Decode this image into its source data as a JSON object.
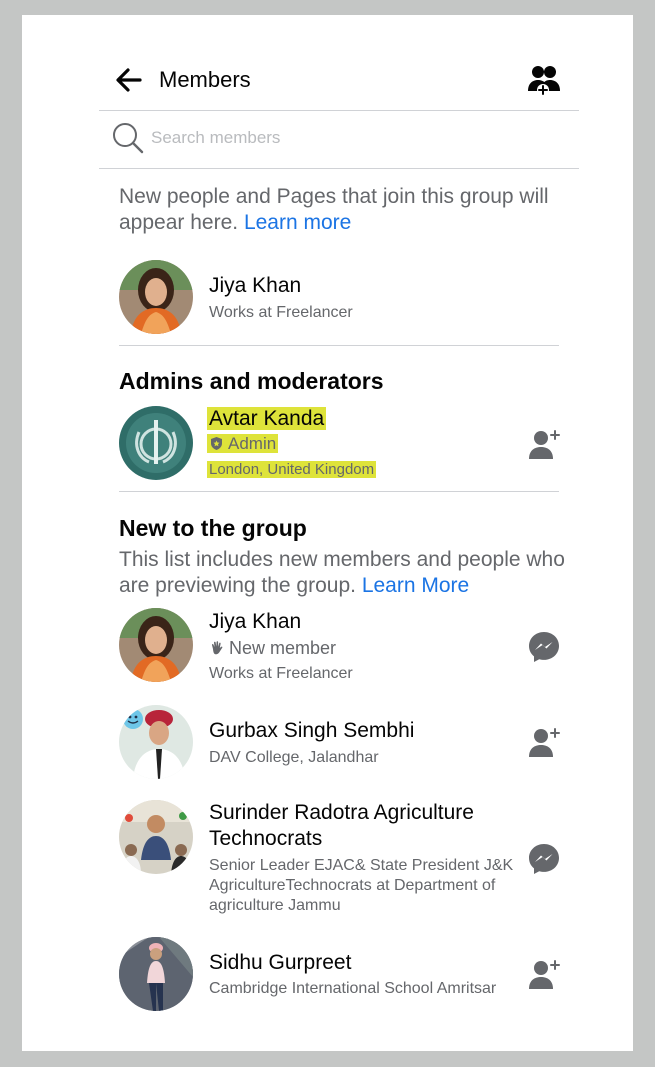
{
  "header": {
    "title": "Members",
    "back_icon": "arrow-left-icon",
    "invite_icon": "add-people-icon"
  },
  "search": {
    "placeholder": "Search members"
  },
  "notice": {
    "text": "New people and Pages that join this group will appear here.",
    "link": "Learn more"
  },
  "recent": {
    "name": "Jiya Khan",
    "subtitle": "Works at Freelancer"
  },
  "admins": {
    "title": "Admins and moderators",
    "member": {
      "name": "Avtar Kanda",
      "role": "Admin",
      "location": "London, United Kingdom",
      "highlight_color": "#dee33a"
    }
  },
  "new_members": {
    "title": "New to the group",
    "description": "This list includes new members and people who are previewing the group.",
    "link": "Learn More",
    "items": [
      {
        "name": "Jiya Khan",
        "badge": "New member",
        "subtitle": "Works at Freelancer",
        "action_icon": "messenger-icon"
      },
      {
        "name": "Gurbax Singh Sembhi",
        "subtitle": "DAV College, Jalandhar",
        "action_icon": "add-friend-icon"
      },
      {
        "name": "Surinder Radotra Agriculture Technocrats",
        "subtitle": "Senior Leader EJAC& State President J&K AgricultureTechnocrats at Department of agriculture Jammu",
        "action_icon": "messenger-icon"
      },
      {
        "name": "Sidhu Gurpreet",
        "subtitle": "Cambridge International School Amritsar",
        "action_icon": "add-friend-icon"
      }
    ]
  },
  "colors": {
    "link": "#1b74e4",
    "secondary_text": "#65676b",
    "background_frame": "#c4c6c5"
  }
}
